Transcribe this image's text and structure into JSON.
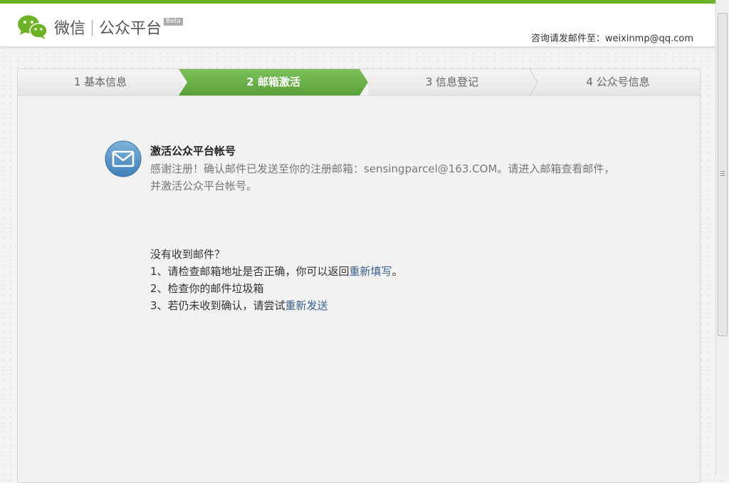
{
  "header": {
    "brand_primary": "微信",
    "brand_secondary": "公众平台",
    "beta": "Beta",
    "contact_label": "咨询请发邮件至：",
    "contact_email": "weixinmp@qq.com"
  },
  "steps": [
    {
      "label": "1 基本信息"
    },
    {
      "label": "2 邮箱激活"
    },
    {
      "label": "3 信息登记"
    },
    {
      "label": "4 公众号信息"
    }
  ],
  "activation": {
    "title": "激活公众平台帐号",
    "desc_prefix": "感谢注册！确认邮件已发送至你的注册邮箱：",
    "email": "sensingparcel@163.COM",
    "desc_suffix": "。请进入邮箱查看邮件，并激活公众平台帐号。"
  },
  "help": {
    "title": "没有收到邮件？",
    "line1_prefix": "1、请检查邮箱地址是否正确，你可以返回",
    "line1_link": "重新填写",
    "line1_suffix": "。",
    "line2": "2、检查你的邮件垃圾箱",
    "line3_prefix": "3、若仍未收到确认，请尝试",
    "line3_link": "重新发送"
  },
  "colors": {
    "brand_green": "#6eb227",
    "active_step": "#5aa03a",
    "link": "#3a5f8f"
  },
  "icons": {
    "logo": "wechat-logo-icon",
    "mail": "mail-envelope-icon"
  }
}
